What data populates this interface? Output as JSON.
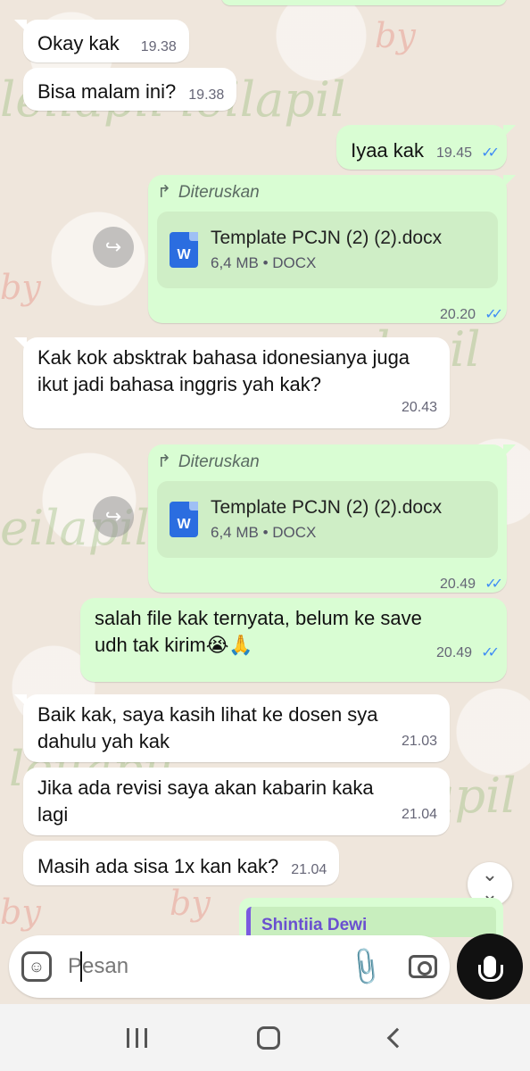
{
  "messages": [
    {
      "dir": "in",
      "text": "Okay kak",
      "time": "19.38"
    },
    {
      "dir": "in",
      "text": "Bisa malam ini?",
      "time": "19.38"
    },
    {
      "dir": "out",
      "text": "Iyaa kak",
      "time": "19.45"
    },
    {
      "dir": "out",
      "forwarded": "Diteruskan",
      "doc_name": "Template PCJN (2) (2).docx",
      "doc_meta": "6,4 MB • DOCX",
      "doc_icon": "W",
      "time": "20.20"
    },
    {
      "dir": "in",
      "text": "Kak kok absktrak bahasa idonesianya juga ikut jadi bahasa inggris yah kak?",
      "time": "20.43"
    },
    {
      "dir": "out",
      "forwarded": "Diteruskan",
      "doc_name": "Template PCJN (2) (2).docx",
      "doc_meta": "6,4 MB • DOCX",
      "doc_icon": "W",
      "time": "20.49"
    },
    {
      "dir": "out",
      "text": "salah file kak ternyata, belum ke save udh tak kirim😭🙏",
      "time": "20.49"
    },
    {
      "dir": "in",
      "text": "Baik kak, saya kasih lihat ke dosen sya dahulu yah kak",
      "time": "21.03"
    },
    {
      "dir": "in",
      "text": "Jika ada revisi saya akan kabarin kaka lagi",
      "time": "21.04"
    },
    {
      "dir": "in",
      "text": "Masih ada sisa 1x kan kak?",
      "time": "21.04"
    }
  ],
  "quote_preview": {
    "sender": "Shintiia Dewi"
  },
  "composer": {
    "placeholder": "Pesan"
  },
  "icons": {
    "read_ticks": "✓✓",
    "forward": "↱",
    "share": "↪",
    "scroll_down": "⌄",
    "attach": "📎",
    "emoji": "sticker-icon",
    "camera": "camera-icon",
    "mic": "mic-icon"
  },
  "colors": {
    "outgoing_bubble": "#d9fdd3",
    "incoming_bubble": "#ffffff",
    "read_ticks": "#3f8cf5",
    "quote_accent": "#7b5be0"
  }
}
